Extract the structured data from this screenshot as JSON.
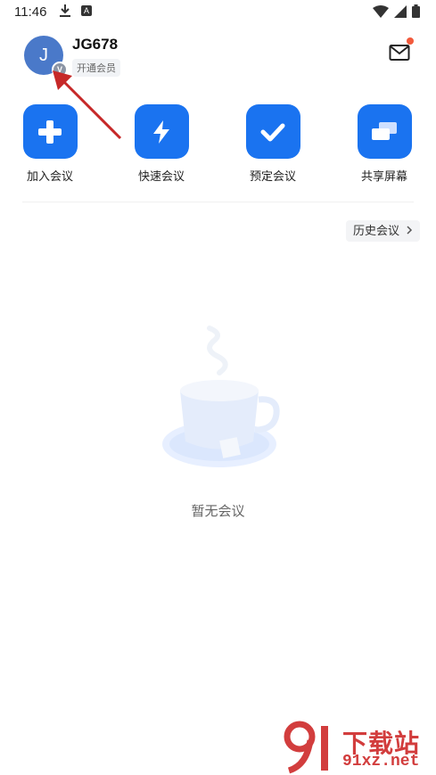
{
  "status_bar": {
    "time": "11:46",
    "icons": [
      "download-icon",
      "app-notification-icon",
      "wifi-icon",
      "signal-icon",
      "battery-icon"
    ]
  },
  "header": {
    "avatar_initial": "J",
    "avatar_badge": "V",
    "username": "JG678",
    "membership_tag": "开通会员",
    "mail_has_notification": true
  },
  "actions": [
    {
      "label": "加入会议",
      "icon": "plus-icon"
    },
    {
      "label": "快速会议",
      "icon": "lightning-icon"
    },
    {
      "label": "预定会议",
      "icon": "check-icon"
    },
    {
      "label": "共享屏幕",
      "icon": "screen-share-icon"
    }
  ],
  "history": {
    "label": "历史会议",
    "icon": "chevron-right-icon"
  },
  "empty_state": {
    "text": "暂无会议",
    "illustration": "coffee-cup-icon"
  },
  "watermark": {
    "title": "下载站",
    "url": "91xz.net"
  },
  "colors": {
    "accent": "#1a73f0",
    "avatar": "#4a79c9",
    "notification_dot": "#f25a3c",
    "watermark": "#d23d3d"
  }
}
